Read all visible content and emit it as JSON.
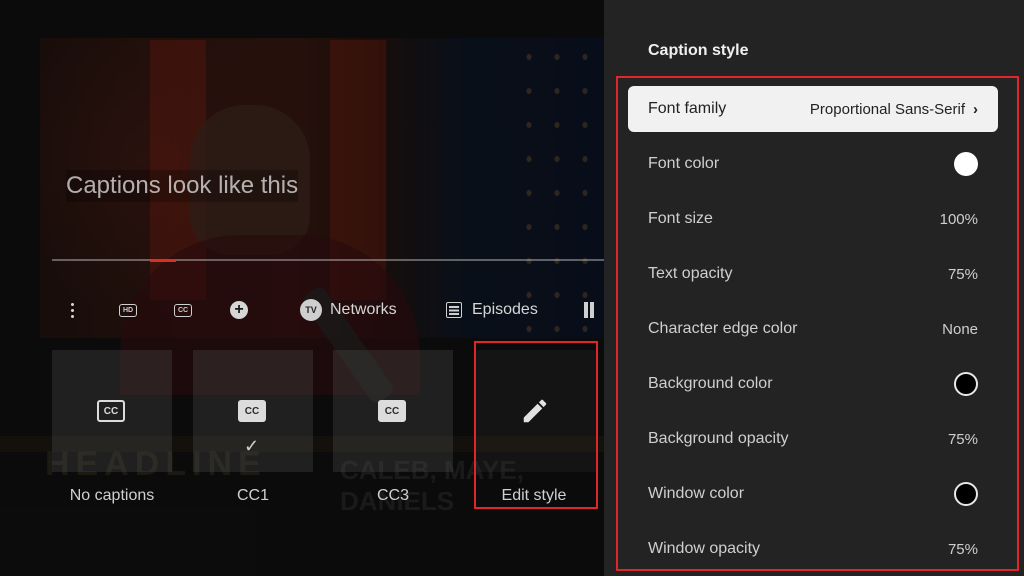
{
  "video": {
    "caption_preview": "Captions look like this",
    "overlay_text_left": "HEADLINE",
    "overlay_text_right": "CALEB, MAYE, DANIELS"
  },
  "controls": {
    "hd_badge": "HD",
    "cc_badge": "CC",
    "networks_badge": "TV",
    "networks_label": "Networks",
    "episodes_label": "Episodes"
  },
  "caption_options": [
    {
      "label": "No captions",
      "icon": "cc-outline-icon"
    },
    {
      "label": "CC1",
      "icon": "cc-filled-icon",
      "selected": true,
      "check": "✓"
    },
    {
      "label": "CC3",
      "icon": "cc-filled-icon"
    },
    {
      "label": "Edit style",
      "icon": "pencil-icon"
    }
  ],
  "cc_icon_text": "CC",
  "panel": {
    "title": "Caption style",
    "rows": [
      {
        "label": "Font family",
        "value": "Proportional Sans-Serif",
        "chevron": "›"
      },
      {
        "label": "Font color",
        "swatch": "#ffffff"
      },
      {
        "label": "Font size",
        "value": "100%"
      },
      {
        "label": "Text opacity",
        "value": "75%"
      },
      {
        "label": "Character edge color",
        "value": "None"
      },
      {
        "label": "Background color",
        "swatch": "#000000"
      },
      {
        "label": "Background opacity",
        "value": "75%"
      },
      {
        "label": "Window color",
        "swatch": "#000000"
      },
      {
        "label": "Window opacity",
        "value": "75%"
      }
    ]
  },
  "colors": {
    "highlight_border": "#e0262b",
    "progress": "#d93025",
    "panel_bg": "#232323"
  }
}
